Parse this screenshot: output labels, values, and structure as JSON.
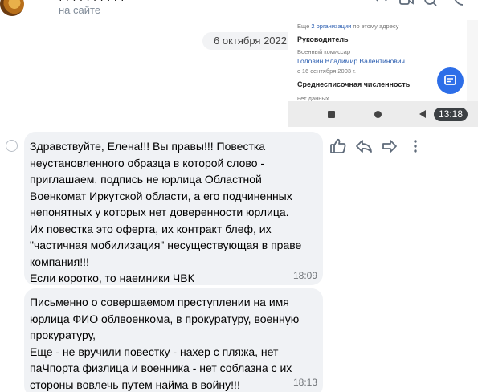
{
  "header": {
    "title_fragment": "· · · · · · · · · ·",
    "status": "на сайте",
    "icons": [
      "avatar",
      "search-icon",
      "phone-icon",
      "video-icon",
      "more-icon"
    ]
  },
  "date_divider": "6 октября 2022",
  "attachment": {
    "org_note_prefix": "Еще ",
    "org_note_link": "2 организации",
    "org_note_suffix": " по этому адресу",
    "head_title": "Руководитель",
    "head_role": "Военный комиссар",
    "head_name": "Головин Владимир Валентинович",
    "head_since": "с 16 сентября 2003 г.",
    "staff_title": "Среднесписочная численность",
    "staff_value": "нет данных",
    "phone_time": "13:18",
    "fab_icon": "message-icon"
  },
  "messages": [
    {
      "text": "Здравствуйте, Елена!!! Вы правы!!! Повестка\nнеустановленного образца в которой слово -\nприглашаем. подпись не юрлица Областной\nВоенкомат Иркутской области, а его подчиненных\nнепонятных у которых нет доверенности юрлица.\nИх повестка это оферта, их контракт блеф, их\n\"частичная мобилизация\" несуществующая в праве\nкомпания!!!\nЕсли коротко, то наемники ЧВК",
      "time": "18:09"
    },
    {
      "text": "Письменно о совершаемом преступлении на имя\nюрлица ФИО облвоенкома, в прокуратуру, военную\nпрокуратуру,\nЕще - не вручили повестку - нахер с пляжа, нет\nпаЧпорта физлица и военника - нет соблазна с их\nстороны вовлечь путем найма в войну!!!",
      "time": "18:13"
    }
  ],
  "message_actions": [
    "like-icon",
    "reply-icon",
    "forward-icon",
    "more-vertical-icon"
  ],
  "colors": {
    "bubble": "#f0f2f5",
    "accent": "#2d6ee8",
    "icon": "#5f6b7a"
  }
}
